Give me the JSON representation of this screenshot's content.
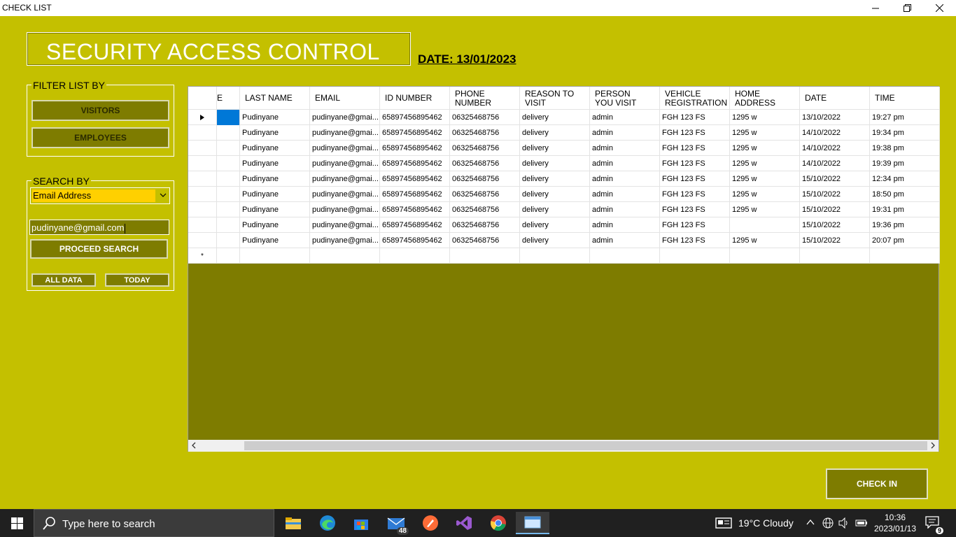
{
  "window": {
    "title": "CHECK LIST"
  },
  "header": {
    "title": "SECURITY ACCESS CONTROL",
    "date": "DATE: 13/01/2023"
  },
  "filter": {
    "legend": "FILTER LIST BY",
    "visitors_label": "VISITORS",
    "employees_label": "EMPLOYEES"
  },
  "search": {
    "legend": "SEARCH BY",
    "selected_field": "Email Address",
    "query_value": "pudinyane@gmail.com",
    "proceed_label": "PROCEED SEARCH",
    "all_data_label": "ALL DATA",
    "today_label": "TODAY"
  },
  "grid": {
    "columns": [
      "E",
      "LAST NAME",
      "EMAIL",
      "ID NUMBER",
      "PHONE NUMBER",
      "REASON TO VISIT",
      "PERSON YOU VISIT",
      "VEHICLE REGISTRATION",
      "HOME ADDRESS",
      "DATE",
      "TIME"
    ],
    "column_lines": [
      [
        "E"
      ],
      [
        "LAST NAME"
      ],
      [
        "EMAIL"
      ],
      [
        "ID NUMBER"
      ],
      [
        "PHONE",
        "NUMBER"
      ],
      [
        "REASON TO",
        "VISIT"
      ],
      [
        "PERSON",
        "YOU VISIT"
      ],
      [
        "VEHICLE",
        "REGISTRATION"
      ],
      [
        "HOME",
        "ADDRESS"
      ],
      [
        "DATE"
      ],
      [
        "TIME"
      ]
    ],
    "rows": [
      [
        "",
        "Pudinyane",
        "pudinyane@gmai...",
        "65897456895462",
        "06325468756",
        "delivery",
        "admin",
        "FGH 123 FS",
        "1295 w",
        "13/10/2022",
        "19:27 pm"
      ],
      [
        "",
        "Pudinyane",
        "pudinyane@gmai...",
        "65897456895462",
        "06325468756",
        "delivery",
        "admin",
        "FGH 123 FS",
        "1295 w",
        "14/10/2022",
        "19:34 pm"
      ],
      [
        "",
        "Pudinyane",
        "pudinyane@gmai...",
        "65897456895462",
        "06325468756",
        "delivery",
        "admin",
        "FGH 123 FS",
        "1295 w",
        "14/10/2022",
        "19:38 pm"
      ],
      [
        "",
        "Pudinyane",
        "pudinyane@gmai...",
        "65897456895462",
        "06325468756",
        "delivery",
        "admin",
        "FGH 123 FS",
        "1295 w",
        "14/10/2022",
        "19:39 pm"
      ],
      [
        "",
        "Pudinyane",
        "pudinyane@gmai...",
        "65897456895462",
        "06325468756",
        "delivery",
        "admin",
        "FGH 123 FS",
        "1295 w",
        "15/10/2022",
        "12:34 pm"
      ],
      [
        "",
        "Pudinyane",
        "pudinyane@gmai...",
        "65897456895462",
        "06325468756",
        "delivery",
        "admin",
        "FGH 123 FS",
        "1295 w",
        "15/10/2022",
        "18:50 pm"
      ],
      [
        "",
        "Pudinyane",
        "pudinyane@gmai...",
        "65897456895462",
        "06325468756",
        "delivery",
        "admin",
        "FGH 123 FS",
        "1295 w",
        "15/10/2022",
        "19:31 pm"
      ],
      [
        "",
        "Pudinyane",
        "pudinyane@gmai...",
        "65897456895462",
        "06325468756",
        "delivery",
        "admin",
        "FGH 123 FS",
        "",
        "15/10/2022",
        "19:36 pm"
      ],
      [
        "",
        "Pudinyane",
        "pudinyane@gmai...",
        "65897456895462",
        "06325468756",
        "delivery",
        "admin",
        "FGH 123 FS",
        "1295 w",
        "15/10/2022",
        "20:07 pm"
      ]
    ],
    "new_row_marker": "*"
  },
  "checkin_label": "CHECK IN",
  "taskbar": {
    "search_placeholder": "Type here to search",
    "mail_badge": "48",
    "weather": "19°C  Cloudy",
    "time": "10:36",
    "date": "2023/01/13",
    "notification_count": "9"
  },
  "colors": {
    "form_bg": "#c4c000",
    "olive": "#7e7c00",
    "selection": "#0078d7",
    "combo_fill": "#ffd000"
  }
}
